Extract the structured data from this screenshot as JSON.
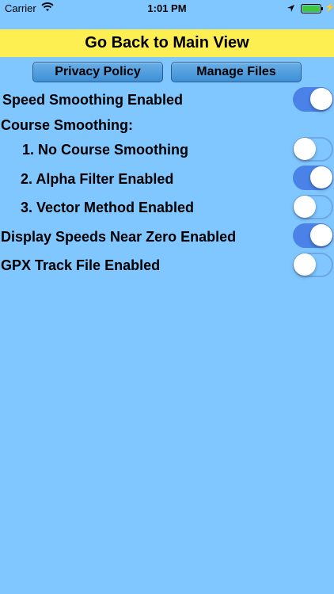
{
  "status_bar": {
    "carrier": "Carrier",
    "time": "1:01 PM",
    "battery_color": "#3ec63e"
  },
  "header": {
    "back_label": "Go Back to Main View",
    "back_color": "#fdee52"
  },
  "buttons": {
    "privacy_label": "Privacy Policy",
    "manage_label": "Manage Files"
  },
  "settings": [
    {
      "label": "Speed Smoothing Enabled",
      "on": true
    },
    {
      "label": "Course Smoothing:"
    },
    {
      "label": "1. No Course Smoothing",
      "on": false
    },
    {
      "label": "2. Alpha Filter Enabled",
      "on": true
    },
    {
      "label": "3. Vector Method Enabled",
      "on": false
    },
    {
      "label": "Display Speeds Near Zero Enabled",
      "on": true
    },
    {
      "label": "GPX Track File Enabled",
      "on": false
    }
  ],
  "colors": {
    "background": "#80c7ff",
    "switch_on": "#4a82e8"
  }
}
